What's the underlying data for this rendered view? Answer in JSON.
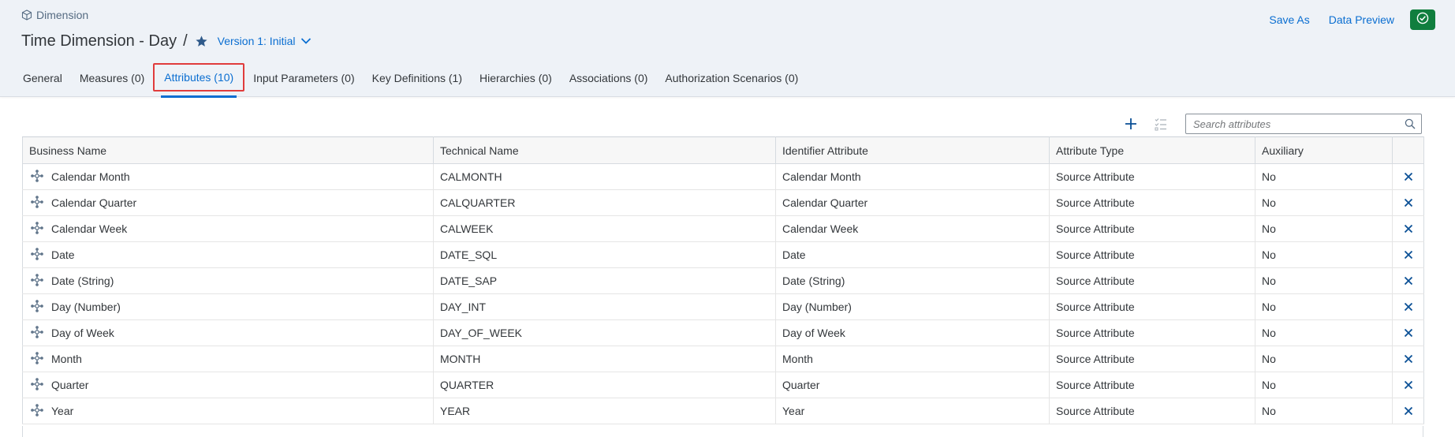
{
  "header": {
    "breadcrumb": "Dimension",
    "title": "Time Dimension - Day",
    "separator": "/",
    "version": "Version 1: Initial"
  },
  "actions": {
    "save_as": "Save As",
    "data_preview": "Data Preview"
  },
  "tabs": [
    {
      "label": "General"
    },
    {
      "label": "Measures (0)"
    },
    {
      "label": "Attributes (10)"
    },
    {
      "label": "Input Parameters (0)"
    },
    {
      "label": "Key Definitions (1)"
    },
    {
      "label": "Hierarchies (0)"
    },
    {
      "label": "Associations (0)"
    },
    {
      "label": "Authorization Scenarios (0)"
    }
  ],
  "search": {
    "placeholder": "Search attributes"
  },
  "table": {
    "columns": [
      "Business Name",
      "Technical Name",
      "Identifier Attribute",
      "Attribute Type",
      "Auxiliary"
    ],
    "rows": [
      {
        "business": "Calendar Month",
        "technical": "CALMONTH",
        "identifier": "Calendar Month",
        "type": "Source Attribute",
        "auxiliary": "No"
      },
      {
        "business": "Calendar Quarter",
        "technical": "CALQUARTER",
        "identifier": "Calendar Quarter",
        "type": "Source Attribute",
        "auxiliary": "No"
      },
      {
        "business": "Calendar Week",
        "technical": "CALWEEK",
        "identifier": "Calendar Week",
        "type": "Source Attribute",
        "auxiliary": "No"
      },
      {
        "business": "Date",
        "technical": "DATE_SQL",
        "identifier": "Date",
        "type": "Source Attribute",
        "auxiliary": "No"
      },
      {
        "business": "Date (String)",
        "technical": "DATE_SAP",
        "identifier": "Date (String)",
        "type": "Source Attribute",
        "auxiliary": "No"
      },
      {
        "business": "Day (Number)",
        "technical": "DAY_INT",
        "identifier": "Day (Number)",
        "type": "Source Attribute",
        "auxiliary": "No"
      },
      {
        "business": "Day of Week",
        "technical": "DAY_OF_WEEK",
        "identifier": "Day of Week",
        "type": "Source Attribute",
        "auxiliary": "No"
      },
      {
        "business": "Month",
        "technical": "MONTH",
        "identifier": "Month",
        "type": "Source Attribute",
        "auxiliary": "No"
      },
      {
        "business": "Quarter",
        "technical": "QUARTER",
        "identifier": "Quarter",
        "type": "Source Attribute",
        "auxiliary": "No"
      },
      {
        "business": "Year",
        "technical": "YEAR",
        "identifier": "Year",
        "type": "Source Attribute",
        "auxiliary": "No"
      }
    ]
  },
  "colors": {
    "accent": "#0a6ed1",
    "success": "#107e3e",
    "highlight_border": "#e03c3c",
    "header_bg": "#eef2f7"
  },
  "icons": {
    "breadcrumb": "cube-icon",
    "favorite": "star-icon",
    "version_toggle": "chevron-down-icon",
    "validate": "check-circle-icon",
    "add": "plus-icon",
    "list_settings": "checklist-icon",
    "search": "search-icon",
    "row_type": "attribute-icon",
    "row_delete": "close-icon"
  }
}
